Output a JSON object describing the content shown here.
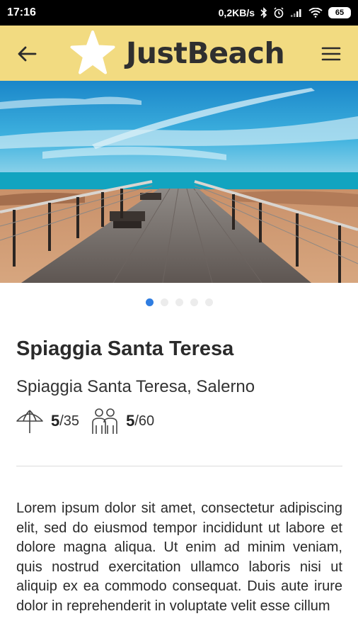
{
  "status_bar": {
    "time": "17:16",
    "network_speed": "0,2KB/s",
    "battery": "65"
  },
  "app_bar": {
    "logo_text": "JustBeach",
    "back_icon": "arrow-left-icon",
    "menu_icon": "hamburger-menu-icon"
  },
  "carousel": {
    "pages": 5,
    "active_index": 0
  },
  "beach": {
    "name": "Spiaggia Santa Teresa",
    "location": "Spiaggia Santa Teresa, Salerno",
    "umbrellas": {
      "available": "5",
      "total": "/35",
      "icon": "umbrella-icon"
    },
    "people": {
      "available": "5",
      "total": "/60",
      "icon": "people-icon"
    }
  },
  "description": "Lorem ipsum dolor sit amet, consectetur adipiscing elit, sed do eiusmod tempor incididunt ut labore et dolore magna aliqua. Ut enim ad minim veniam, quis nostrud exercitation ullamco laboris nisi ut aliquip ex ea commodo consequat. Duis aute irure dolor in reprehenderit in voluptate velit esse cillum",
  "colors": {
    "app_bar": "#f2db81",
    "active_dot": "#2f7de1",
    "inactive_dot": "#ececec"
  }
}
